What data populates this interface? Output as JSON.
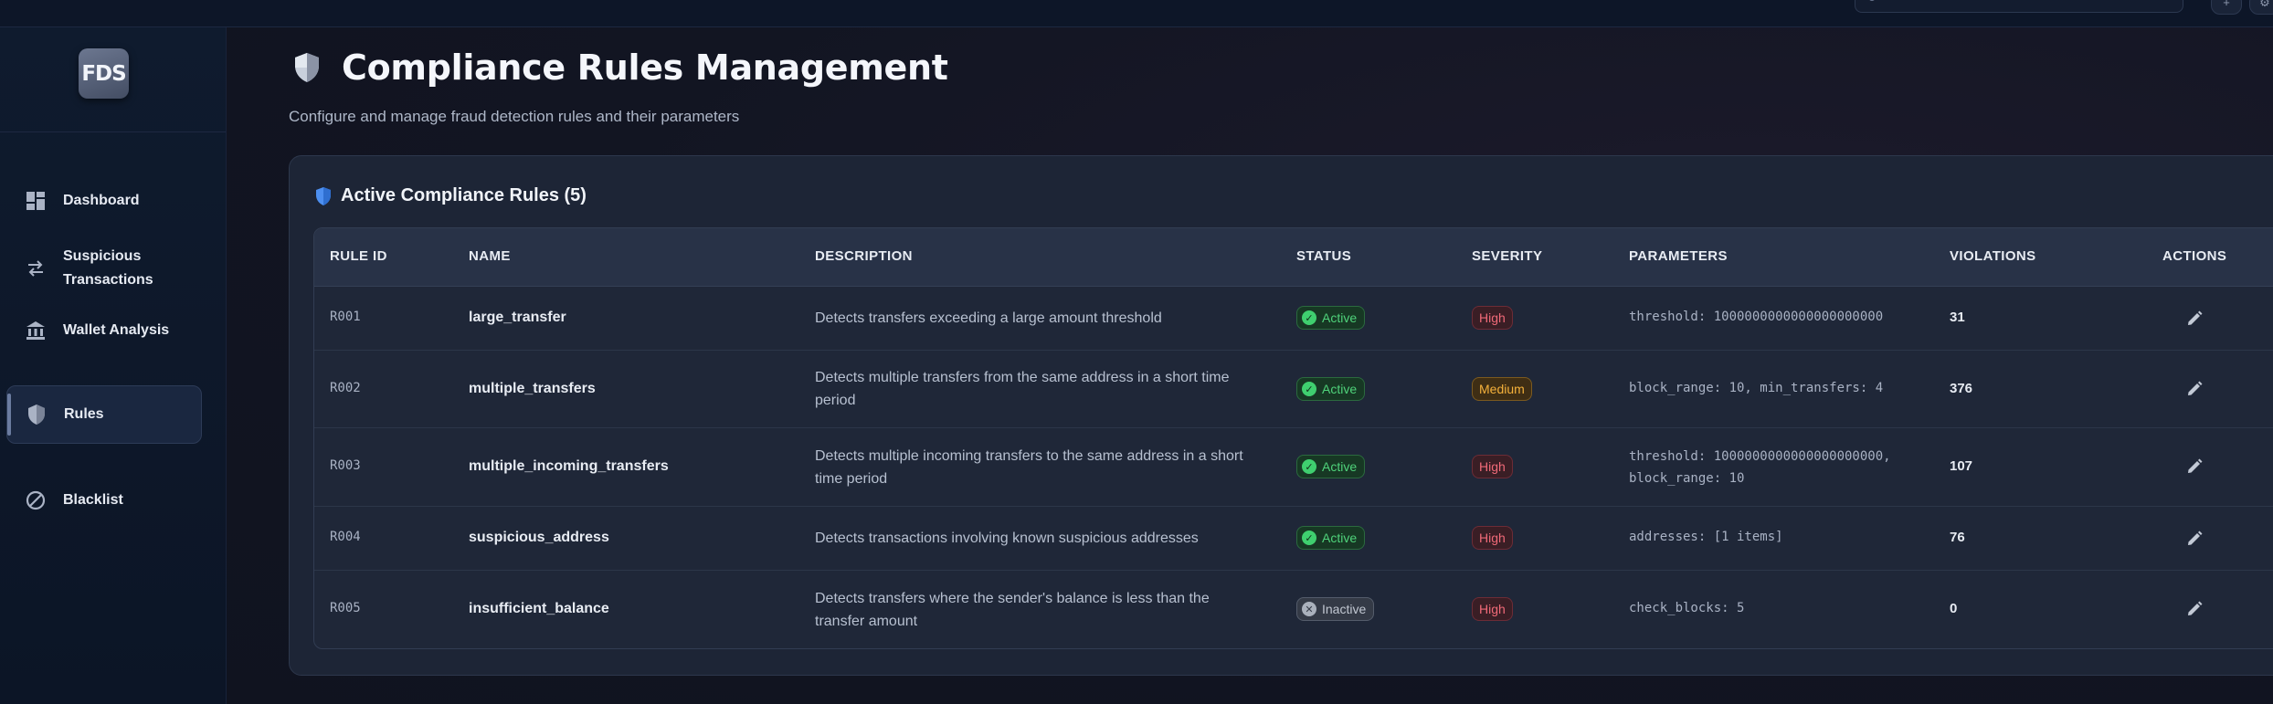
{
  "sidebar": {
    "logo": "FDS",
    "items": [
      {
        "label": "Dashboard",
        "icon": "dashboard-icon"
      },
      {
        "label": "Suspicious Transactions",
        "icon": "transfer-arrows-icon"
      },
      {
        "label": "Wallet Analysis",
        "icon": "bank-icon"
      },
      {
        "label": "Rules",
        "icon": "shield-icon",
        "active": true
      },
      {
        "label": "Blacklist",
        "icon": "block-icon"
      }
    ]
  },
  "header": {
    "title": "Compliance Rules Management",
    "subtitle": "Configure and manage fraud detection rules and their parameters"
  },
  "card": {
    "title": "Active Compliance Rules (5)"
  },
  "table": {
    "headers": [
      "RULE ID",
      "NAME",
      "DESCRIPTION",
      "STATUS",
      "SEVERITY",
      "PARAMETERS",
      "VIOLATIONS",
      "ACTIONS"
    ],
    "rows": [
      {
        "id": "R001",
        "name": "large_transfer",
        "description": "Detects transfers exceeding a large amount threshold",
        "status": "Active",
        "severity": "High",
        "parameters": "threshold: 1000000000000000000000",
        "violations": "31"
      },
      {
        "id": "R002",
        "name": "multiple_transfers",
        "description": "Detects multiple transfers from the same address in a short time period",
        "status": "Active",
        "severity": "Medium",
        "parameters": "block_range: 10, min_transfers: 4",
        "violations": "376"
      },
      {
        "id": "R003",
        "name": "multiple_incoming_transfers",
        "description": "Detects multiple incoming transfers to the same address in a short time period",
        "status": "Active",
        "severity": "High",
        "parameters": "threshold: 1000000000000000000000, block_range: 10",
        "violations": "107"
      },
      {
        "id": "R004",
        "name": "suspicious_address",
        "description": "Detects transactions involving known suspicious addresses",
        "status": "Active",
        "severity": "High",
        "parameters": "addresses: [1 items]",
        "violations": "76"
      },
      {
        "id": "R005",
        "name": "insufficient_balance",
        "description": "Detects transfers where the sender's balance is less than the transfer amount",
        "status": "Inactive",
        "severity": "High",
        "parameters": "check_blocks: 5",
        "violations": "0"
      }
    ]
  },
  "colors": {
    "active_status": "#4fd27a",
    "high_severity": "#f06a78",
    "medium_severity": "#f5b13b",
    "inactive_status": "#c1c7d1"
  }
}
